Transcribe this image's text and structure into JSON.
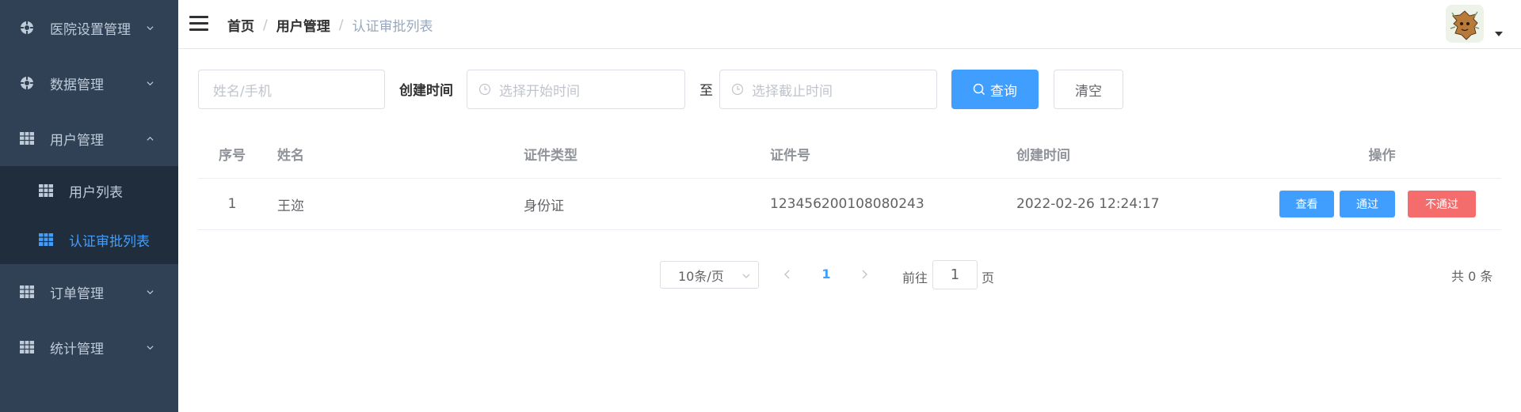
{
  "sidebar": {
    "items": [
      {
        "label": "医院设置管理",
        "icon": "gear-icon",
        "expanded": false
      },
      {
        "label": "数据管理",
        "icon": "gear-icon",
        "expanded": false
      },
      {
        "label": "用户管理",
        "icon": "grid-icon",
        "expanded": true,
        "children": [
          {
            "label": "用户列表",
            "icon": "grid-icon",
            "active": false
          },
          {
            "label": "认证审批列表",
            "icon": "grid-icon",
            "active": true
          }
        ]
      },
      {
        "label": "订单管理",
        "icon": "grid-icon",
        "expanded": false
      },
      {
        "label": "统计管理",
        "icon": "grid-icon",
        "expanded": false
      }
    ]
  },
  "header": {
    "breadcrumb": [
      "首页",
      "用户管理",
      "认证审批列表"
    ],
    "separator": "/"
  },
  "filters": {
    "name_placeholder": "姓名/手机",
    "created_label": "创建时间",
    "start_placeholder": "选择开始时间",
    "to_label": "至",
    "end_placeholder": "选择截止时间",
    "search_label": "查询",
    "clear_label": "清空"
  },
  "table": {
    "columns": [
      "序号",
      "姓名",
      "证件类型",
      "证件号",
      "创建时间",
      "操作"
    ],
    "rows": [
      {
        "index": "1",
        "name": "王迩",
        "cert_type": "身份证",
        "cert_no": "123456200108080243",
        "created": "2022-02-26 12:24:17"
      }
    ],
    "actions": {
      "view": "查看",
      "pass": "通过",
      "reject": "不通过"
    }
  },
  "pagination": {
    "page_size": "10条/页",
    "current_page": "1",
    "goto_label": "前往",
    "goto_value": "1",
    "page_suffix": "页",
    "total": "共 0 条"
  },
  "colors": {
    "sidebar_bg": "#304156",
    "submenu_bg": "#1f2d3d",
    "primary": "#409eff",
    "danger": "#f56c6c"
  }
}
